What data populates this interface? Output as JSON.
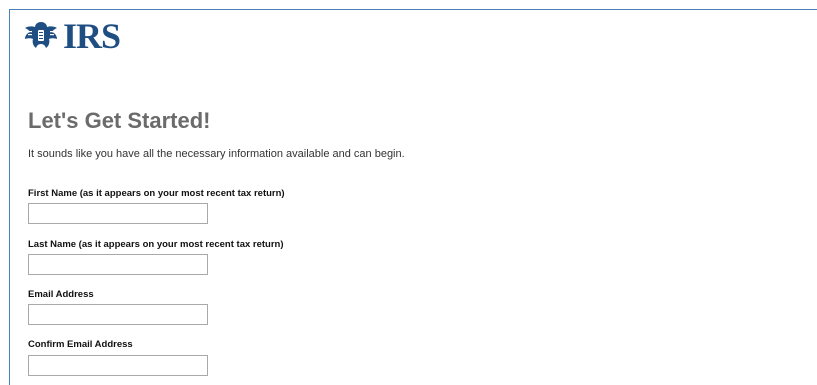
{
  "header": {
    "logo_text": "IRS",
    "logo_icon": "irs-eagle-logo-icon",
    "brand_color": "#1f4f82"
  },
  "main": {
    "title": "Let's Get Started!",
    "intro": "It sounds like you have all the necessary information available and can begin.",
    "fields": [
      {
        "label": "First Name (as it appears on your most recent tax return)",
        "value": ""
      },
      {
        "label": "Last Name (as it appears on your most recent tax return)",
        "value": ""
      },
      {
        "label": "Email Address",
        "value": ""
      },
      {
        "label": "Confirm Email Address",
        "value": ""
      }
    ]
  },
  "colors": {
    "frame_border": "#4a7fb8",
    "title_gray": "#6b6b6b",
    "input_border": "#a9a9a9"
  }
}
